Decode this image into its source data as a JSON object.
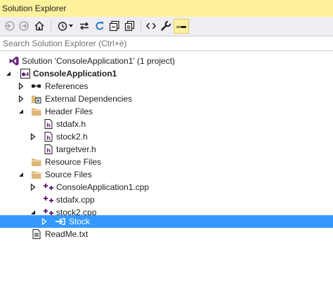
{
  "window": {
    "title": "Solution Explorer"
  },
  "toolbar": {
    "buttons": [
      "back-icon",
      "forward-icon",
      "home-icon",
      "history-icon",
      "dropdown-icon",
      "sync-icon",
      "refresh-icon",
      "collapse-all-icon",
      "show-all-files-icon",
      "view-code-icon",
      "properties-icon",
      "preview-selected-icon"
    ],
    "active_button": "preview-selected-icon"
  },
  "search": {
    "placeholder": "Search Solution Explorer (Ctrl+è)",
    "value": ""
  },
  "tree": {
    "items": [
      {
        "label": "Solution 'ConsoleApplication1' (1 project)",
        "icon": "solution-icon",
        "expander": "none",
        "bold": false
      },
      {
        "label": "ConsoleApplication1",
        "icon": "project-icon",
        "expander": "expanded",
        "bold": true
      },
      {
        "label": "References",
        "icon": "references-icon",
        "expander": "collapsed",
        "bold": false
      },
      {
        "label": "External Dependencies",
        "icon": "external-dependencies-icon",
        "expander": "collapsed",
        "bold": false
      },
      {
        "label": "Header Files",
        "icon": "folder-icon",
        "expander": "expanded",
        "bold": false
      },
      {
        "label": "stdafx.h",
        "icon": "header-file-icon",
        "expander": "none",
        "bold": false
      },
      {
        "label": "stock2.h",
        "icon": "header-file-icon",
        "expander": "collapsed",
        "bold": false
      },
      {
        "label": "targetver.h",
        "icon": "header-file-icon",
        "expander": "none",
        "bold": false
      },
      {
        "label": "Resource Files",
        "icon": "folder-icon",
        "expander": "none",
        "bold": false
      },
      {
        "label": "Source Files",
        "icon": "folder-icon",
        "expander": "expanded",
        "bold": false
      },
      {
        "label": "ConsoleApplication1.cpp",
        "icon": "cpp-file-icon",
        "expander": "collapsed",
        "bold": false
      },
      {
        "label": "stdafx.cpp",
        "icon": "cpp-file-icon",
        "expander": "none",
        "bold": false
      },
      {
        "label": "stock2.cpp",
        "icon": "cpp-file-icon",
        "expander": "expanded",
        "bold": false
      },
      {
        "label": "Stock",
        "icon": "class-icon",
        "expander": "collapsed",
        "bold": false,
        "selected": true
      },
      {
        "label": "ReadMe.txt",
        "icon": "text-file-icon",
        "expander": "none",
        "bold": false
      }
    ]
  },
  "colors": {
    "titlebar_bg": "#fff29d",
    "toolbar_bg": "#eeeef2",
    "selection_bg": "#3399ff",
    "cpp_icon": "#68217a",
    "folder_icon": "#dcb67a"
  }
}
